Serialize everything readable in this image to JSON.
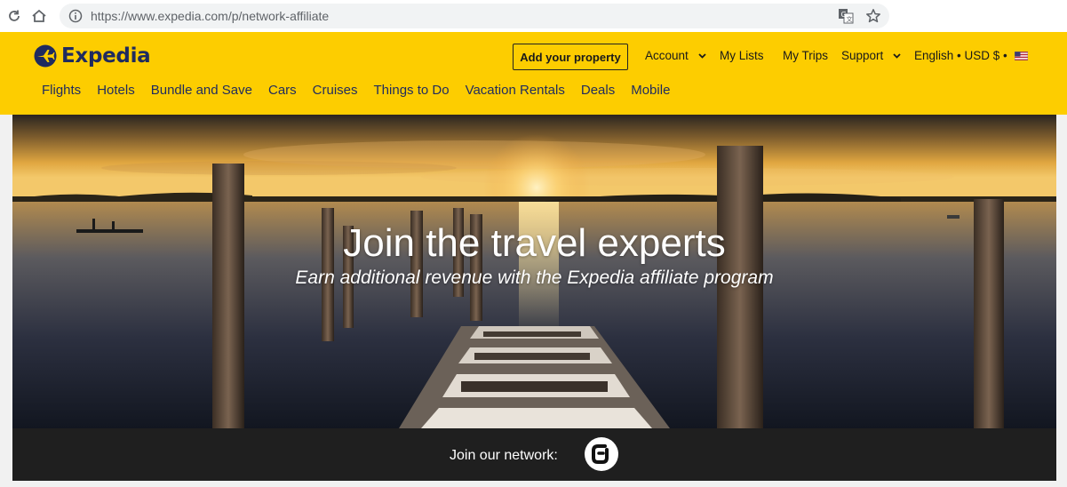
{
  "browser": {
    "url": "https://www.expedia.com/p/network-affiliate"
  },
  "header": {
    "brand": "Expedia",
    "add_property": "Add your property",
    "account": "Account",
    "my_lists": "My Lists",
    "my_trips": "My Trips",
    "support": "Support",
    "locale": "English • USD $ •",
    "colors": {
      "background": "#fdcd00",
      "brand": "#1f2b5f"
    }
  },
  "nav": {
    "items": [
      "Flights",
      "Hotels",
      "Bundle and Save",
      "Cars",
      "Cruises",
      "Things to Do",
      "Vacation Rentals",
      "Deals",
      "Mobile"
    ]
  },
  "hero": {
    "title": "Join the travel experts",
    "subtitle": "Earn additional revenue with the Expedia affiliate program"
  },
  "network": {
    "label": "Join our network:",
    "icon": "cj-logo-icon"
  }
}
